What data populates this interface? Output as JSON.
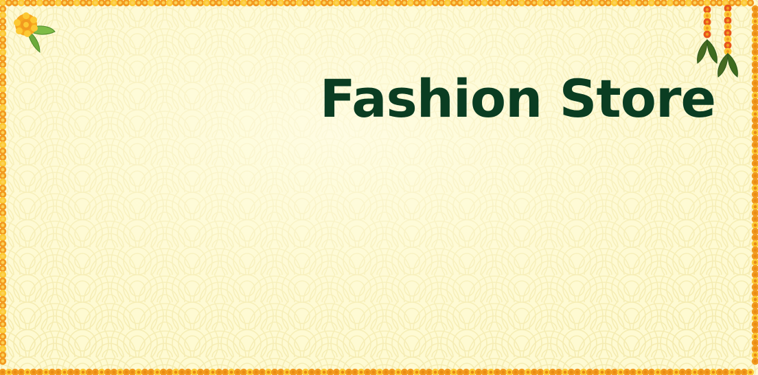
{
  "store": {
    "title": "Fashion Store"
  },
  "theme": {
    "background": "#fefad2",
    "pattern_line": "#f6edb2",
    "title_color": "#0a3d22",
    "marigold_orange": "#f29a1f",
    "marigold_yellow": "#fcc934",
    "marigold_red": "#e8551b",
    "leaf_green": "#6cab3c",
    "leaf_dark": "#2f5a1e"
  },
  "decorations": {
    "border": "marigold-border",
    "top_left": "marigold-flower-icon",
    "top_right": "marigold-garland-icon"
  }
}
